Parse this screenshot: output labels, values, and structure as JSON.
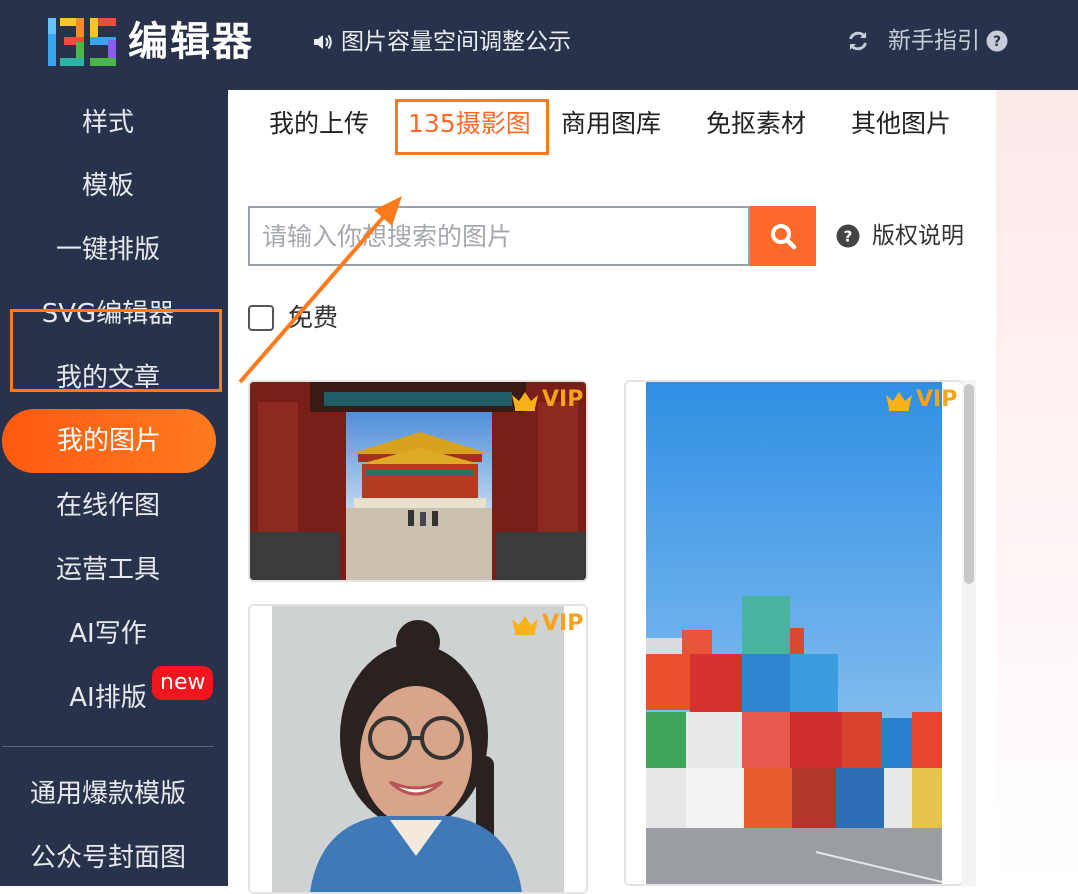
{
  "header": {
    "logo_text": "编辑器",
    "notice_text": "图片容量空间调整公示",
    "guide_text": "新手指引"
  },
  "sidebar": {
    "items": [
      {
        "label": "样式"
      },
      {
        "label": "模板"
      },
      {
        "label": "一键排版"
      },
      {
        "label": "SVG编辑器"
      },
      {
        "label": "我的文章"
      },
      {
        "label": "我的图片",
        "active": true
      },
      {
        "label": "在线作图"
      },
      {
        "label": "运营工具"
      },
      {
        "label": "AI写作"
      },
      {
        "label": "AI排版",
        "badge": "new"
      },
      {
        "label": "通用爆款模版"
      },
      {
        "label": "公众号封面图"
      }
    ]
  },
  "tabs": [
    {
      "label": "我的上传"
    },
    {
      "label": "135摄影图",
      "active": true
    },
    {
      "label": "商用图库"
    },
    {
      "label": "免抠素材"
    },
    {
      "label": "其他图片"
    }
  ],
  "search": {
    "placeholder": "请输入你想搜索的图片",
    "value": "",
    "copyright_label": "版权说明"
  },
  "filter": {
    "free_label": "免费",
    "checked": false
  },
  "images": [
    {
      "name": "forbidden-city-photo",
      "badge": "VIP"
    },
    {
      "name": "containers-photo",
      "badge": "VIP"
    },
    {
      "name": "smiling-girl-photo",
      "badge": "VIP"
    }
  ],
  "colors": {
    "topbar_bg": "#28324a",
    "accent": "#ff6a26",
    "vip": "#f7a21b",
    "new_badge": "#f0161e"
  }
}
